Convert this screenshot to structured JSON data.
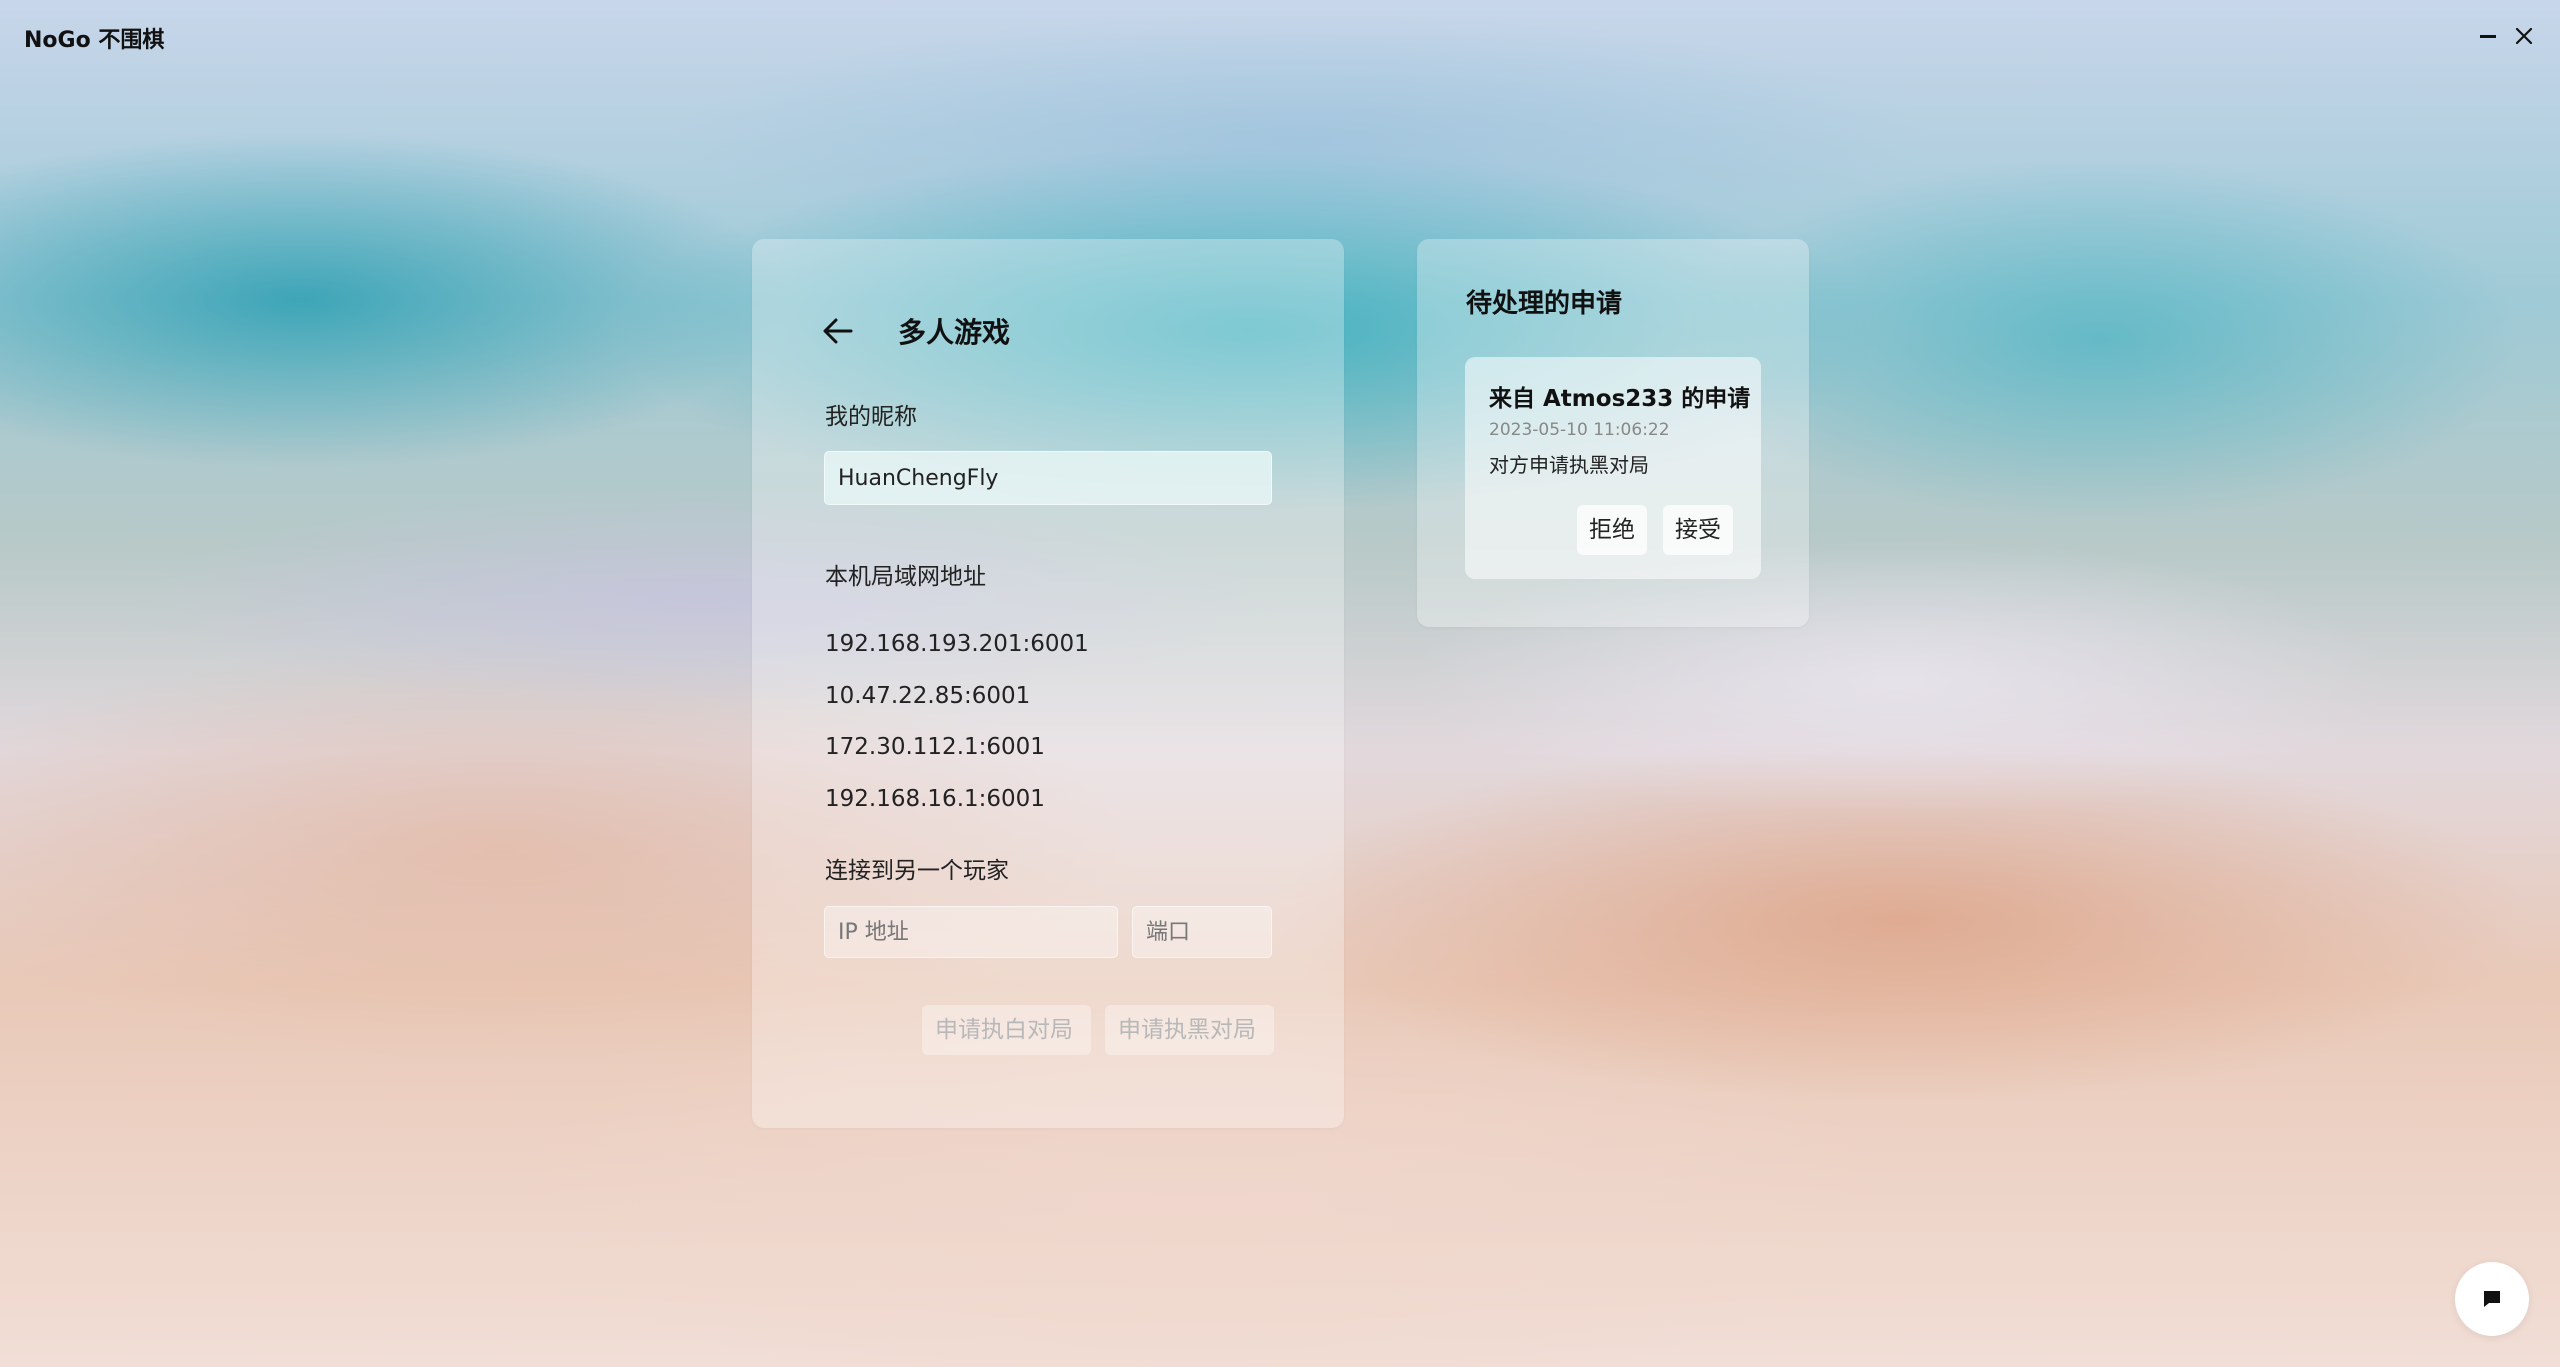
{
  "app": {
    "title": "NoGo 不围棋"
  },
  "window_controls": {
    "minimize_icon": "minimize-icon",
    "close_icon": "close-icon"
  },
  "multiplayer": {
    "title": "多人游戏",
    "back_icon": "arrow-left-icon",
    "nickname_label": "我的昵称",
    "nickname_value": "HuanChengFly",
    "lan_label": "本机局域网地址",
    "lan_addresses": [
      "192.168.193.201:6001",
      "10.47.22.85:6001",
      "172.30.112.1:6001",
      "192.168.16.1:6001"
    ],
    "connect_label": "连接到另一个玩家",
    "ip_placeholder": "IP 地址",
    "port_placeholder": "端口",
    "request_white_label": "申请执白对局",
    "request_black_label": "申请执黑对局"
  },
  "pending": {
    "title": "待处理的申请",
    "requests": [
      {
        "title": "来自 Atmos233 的申请",
        "time": "2023-05-10 11:06:22",
        "description": "对方申请执黑对局",
        "reject_label": "拒绝",
        "accept_label": "接受"
      }
    ]
  },
  "chat": {
    "icon": "chat-bubble-icon"
  }
}
